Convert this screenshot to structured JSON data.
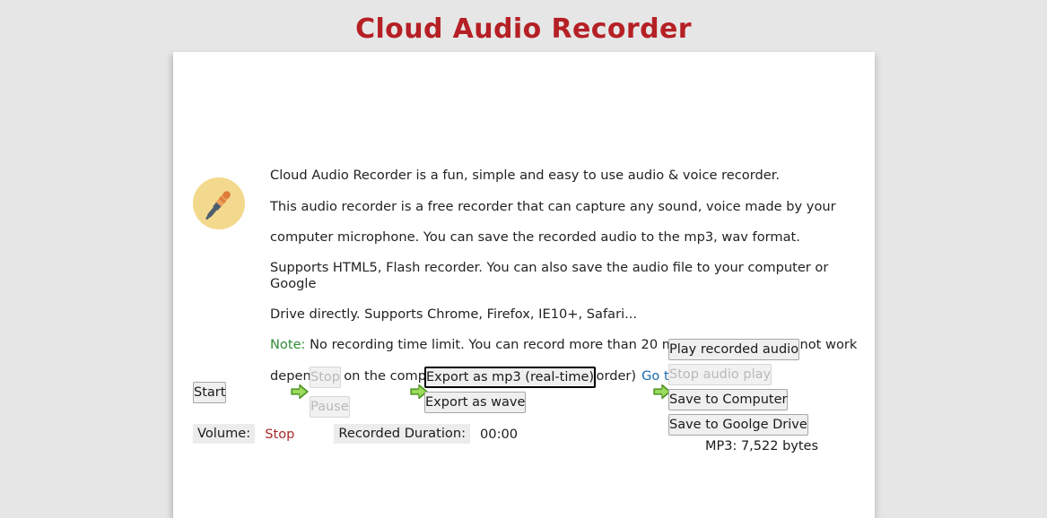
{
  "page": {
    "title": "Cloud Audio Recorder",
    "title_color": "#b52025",
    "background_color": "#e6e6e6",
    "card_color": "#ffffff"
  },
  "intro": {
    "icon": "microphone-icon",
    "lines": [
      "Cloud Audio Recorder is a fun, simple and easy to use audio & voice recorder.",
      "This audio recorder is a free recorder that can capture any sound, voice made by your",
      "computer microphone. You can save the recorded audio to the mp3, wav format.",
      "Supports HTML5, Flash recorder. You can also save the audio file to your computer or Google",
      "Drive directly. Supports Chrome, Firefox, IE10+, Safari..."
    ],
    "note_label": "Note:",
    "note_color": "#2f8b36",
    "note_line1": " No recording time limit. You can record more than 20 minutes. But, It may not work",
    "note_line2": "depending on the computer memory. (HTML5 Recorder)",
    "flash_link": "Go to Flash version",
    "link_color": "#1569b0"
  },
  "controls": {
    "start": "Start",
    "stop": "Stop",
    "pause": "Pause",
    "export_mp3": "Export as mp3 (real-time)",
    "export_wave": "Export as wave",
    "play_recorded": "Play recorded audio",
    "stop_audio_play": "Stop audio play",
    "save_computer": "Save to Computer",
    "save_drive": "Save to Goolge Drive",
    "mp3_size": "MP3: 7,522 bytes",
    "arrow_icon": "green-right-arrow-icon"
  },
  "status": {
    "volume_label": "Volume:",
    "volume_value": "Stop",
    "volume_value_color": "#a52a2a",
    "duration_label": "Recorded Duration:",
    "duration_value": "00:00"
  }
}
